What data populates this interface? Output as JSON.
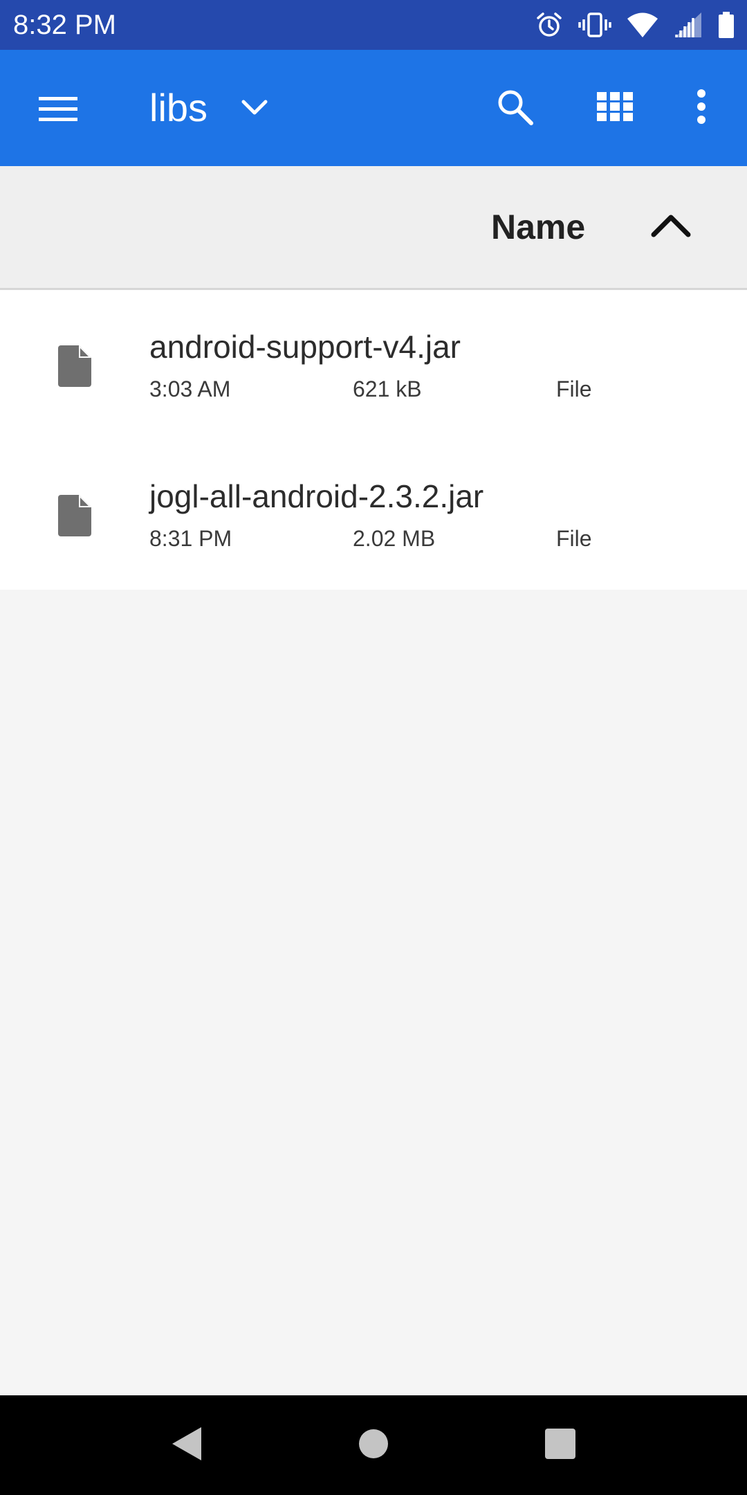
{
  "status_bar": {
    "time": "8:32 PM",
    "icons": [
      "alarm-icon",
      "vibrate-icon",
      "wifi-icon",
      "signal-icon",
      "battery-icon"
    ]
  },
  "app_bar": {
    "title": "libs",
    "icons": [
      "menu-icon",
      "chevron-down-icon",
      "search-icon",
      "grid-view-icon",
      "more-vert-icon"
    ],
    "color": "#1e74e6"
  },
  "sort_bar": {
    "label": "Name",
    "direction_icon": "chevron-up-icon"
  },
  "files": [
    {
      "name": "android-support-v4.jar",
      "date": "3:03 AM",
      "size": "621 kB",
      "kind": "File"
    },
    {
      "name": "jogl-all-android-2.3.2.jar",
      "date": "8:31 PM",
      "size": "2.02 MB",
      "kind": "File"
    }
  ],
  "nav_bar": {
    "icons": [
      "back-icon",
      "home-icon",
      "recents-icon"
    ]
  }
}
